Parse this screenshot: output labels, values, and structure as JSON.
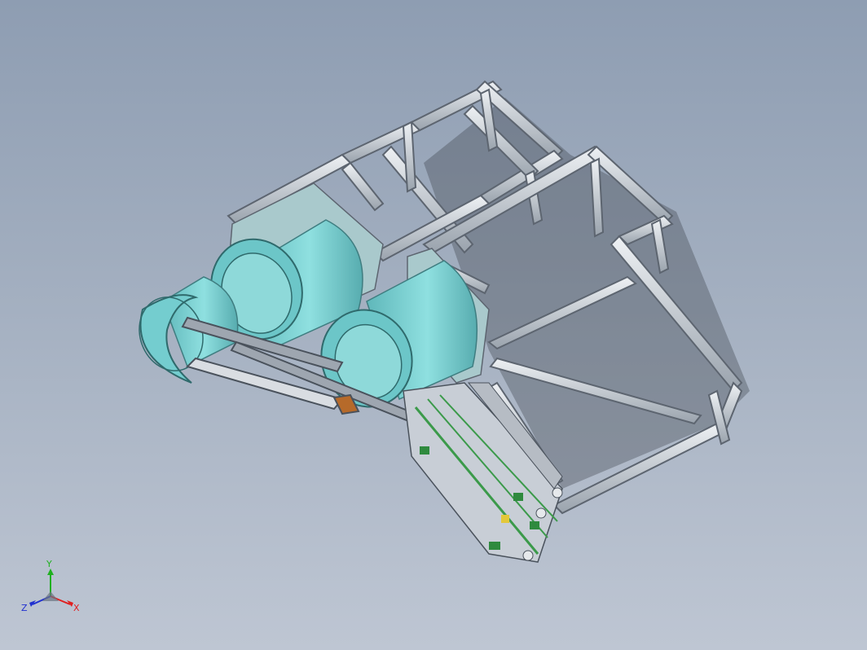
{
  "view": {
    "background_top": "#8e9db2",
    "background_bottom": "#bec6d3"
  },
  "model": {
    "frame_color": "#d4d9e0",
    "frame_edge": "#5d6570",
    "drum_color": "#7fd3d3",
    "drum_shadow": "#4ea3a6",
    "plate_color": "#a9c9cc",
    "conveyor_accent": "#3b9a4a"
  },
  "triad": {
    "x_label": "X",
    "y_label": "Y",
    "z_label": "Z",
    "x_color": "#e02020",
    "y_color": "#20b020",
    "z_color": "#2030d0"
  }
}
